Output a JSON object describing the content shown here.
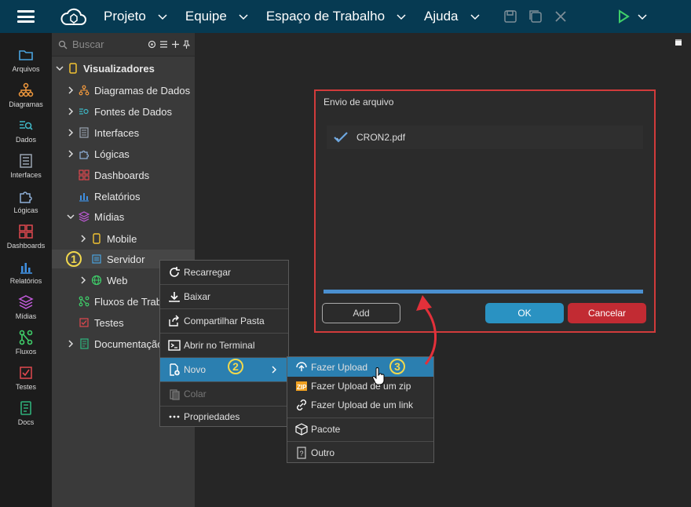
{
  "topbar": {
    "menus": [
      "Projeto",
      "Equipe",
      "Espaço de Trabalho",
      "Ajuda"
    ]
  },
  "rail": [
    {
      "label": "Arquivos",
      "icon": "folder-icon",
      "color": "#4aa3df"
    },
    {
      "label": "Diagramas",
      "icon": "diagram-icon",
      "color": "#f39a3d"
    },
    {
      "label": "Dados",
      "icon": "data-icon",
      "color": "#3fb6c4"
    },
    {
      "label": "Interfaces",
      "icon": "interface-icon",
      "color": "#9aa4b2"
    },
    {
      "label": "Lógicas",
      "icon": "puzzle-icon",
      "color": "#8fb0d8"
    },
    {
      "label": "Dashboards",
      "icon": "dashboard-icon",
      "color": "#e0484f"
    },
    {
      "label": "Relatórios",
      "icon": "report-icon",
      "color": "#3f8fe0"
    },
    {
      "label": "Mídias",
      "icon": "media-icon",
      "color": "#c35bdc"
    },
    {
      "label": "Fluxos",
      "icon": "flow-icon",
      "color": "#3fcf6a"
    },
    {
      "label": "Testes",
      "icon": "test-icon",
      "color": "#e0484f"
    },
    {
      "label": "Docs",
      "icon": "docs-icon",
      "color": "#2fb07a"
    }
  ],
  "tree": {
    "search_placeholder": "Buscar",
    "root": "Visualizadores",
    "items": [
      {
        "label": "Diagramas de Dados"
      },
      {
        "label": "Fontes de Dados"
      },
      {
        "label": "Interfaces"
      },
      {
        "label": "Lógicas"
      },
      {
        "label": "Dashboards"
      },
      {
        "label": "Relatórios"
      },
      {
        "label": "Mídias"
      },
      {
        "label": "Mobile"
      },
      {
        "label": "Servidor"
      },
      {
        "label": "Web"
      },
      {
        "label": "Fluxos de Trabalho"
      },
      {
        "label": "Testes"
      },
      {
        "label": "Documentação"
      }
    ]
  },
  "context_menu": {
    "items": [
      "Recarregar",
      "Baixar",
      "Compartilhar Pasta",
      "Abrir no Terminal",
      "Novo",
      "Colar",
      "Propriedades"
    ]
  },
  "submenu": {
    "items": [
      "Fazer Upload",
      "Fazer Upload de um zip",
      "Fazer Upload de um link",
      "Pacote",
      "Outro"
    ]
  },
  "dialog": {
    "title": "Envio de arquivo",
    "file": "CRON2.pdf",
    "progress": 1.0,
    "add_label": "Add",
    "ok_label": "OK",
    "cancel_label": "Cancelar"
  },
  "badges": [
    "1",
    "2",
    "3"
  ]
}
